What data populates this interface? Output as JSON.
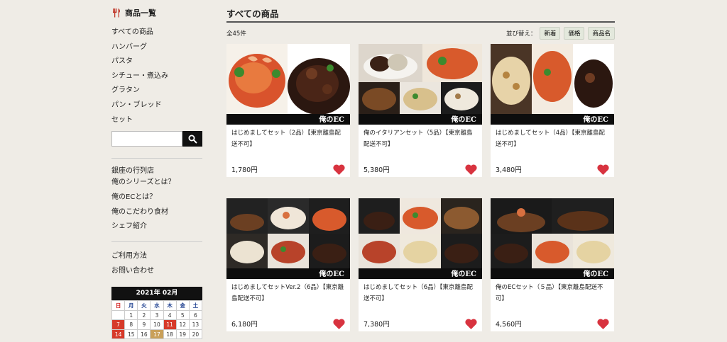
{
  "sidebar": {
    "header": "商品一覧",
    "nav": [
      "すべての商品",
      "ハンバーグ",
      "パスタ",
      "シチュー・煮込み",
      "グラタン",
      "パン・ブレッド",
      "セット"
    ],
    "search_placeholder": "",
    "info_a": [
      "銀座の行列店",
      "俺のシリーズとは？",
      "俺のECとは？",
      "俺のこだわり食材",
      "シェフ紹介"
    ],
    "info_b": [
      "ご利用方法",
      "お問い合わせ"
    ]
  },
  "calendar": {
    "title": "2021年 02月",
    "weekdays": [
      "日",
      "月",
      "火",
      "水",
      "木",
      "金",
      "土"
    ],
    "rows": [
      [
        "",
        "1",
        "2",
        "3",
        "4",
        "5",
        "6"
      ],
      [
        "7",
        "8",
        "9",
        "10",
        "11",
        "12",
        "13"
      ],
      [
        "14",
        "15",
        "16",
        "17",
        "18",
        "19",
        "20"
      ]
    ],
    "holidays": [
      "7",
      "11",
      "14"
    ],
    "today": "17"
  },
  "main": {
    "title": "すべての商品",
    "count": "全45件",
    "sort_label": "並び替え：",
    "sort_options": [
      "新着",
      "価格",
      "商品名"
    ]
  },
  "logo_text": "俺のEC",
  "products": [
    {
      "name": "はじめましてセット（2品）【東京離島配送不可】",
      "price": "1,780円"
    },
    {
      "name": "俺のイタリアンセット（5品）【東京離島配送不可】",
      "price": "5,380円"
    },
    {
      "name": "はじめましてセット（4品）【東京離島配送不可】",
      "price": "3,480円"
    },
    {
      "name": "はじめましてセットVer.2（6品）【東京離島配送不可】",
      "price": "6,180円"
    },
    {
      "name": "はじめましてセット（6品）【東京離島配送不可】",
      "price": "7,380円"
    },
    {
      "name": "俺のECセット（５品）【東京離島配送不可】",
      "price": "4,560円"
    }
  ],
  "colors": {
    "heart": "#d8333f",
    "background": "#efece6",
    "calendar_holiday": "#d63a2a",
    "calendar_today": "#c9a05a"
  }
}
